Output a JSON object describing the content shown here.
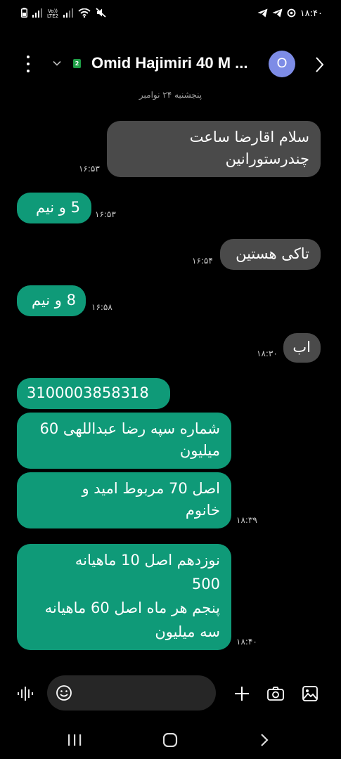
{
  "status_bar": {
    "time": "۱۸:۴۰",
    "network_label_top": "Vo))",
    "network_label_bottom": "LTE2",
    "icons": [
      "battery-icon",
      "signal-icon",
      "signal-icon",
      "wifi-icon",
      "mute-icon",
      "telegram-icon",
      "telegram-icon",
      "sync-icon"
    ]
  },
  "header": {
    "contact_name": "Omid Hajimiri 40 M ...",
    "sim_badge": "2",
    "avatar_letter": "O",
    "avatar_color": "#7d8ce6"
  },
  "date_label": "پنجشنبه ۲۴ نوامبر",
  "messages": [
    {
      "direction": "sent",
      "text": "سلام اقارضا ساعت\nچندرستورانین",
      "time": "۱۶:۵۳"
    },
    {
      "direction": "received",
      "text": "5 و نیم",
      "time": "۱۶:۵۳"
    },
    {
      "direction": "sent",
      "text": "تاکی هستین",
      "time": "۱۶:۵۴"
    },
    {
      "direction": "received",
      "text": "8 و نیم",
      "time": "۱۶:۵۸"
    },
    {
      "direction": "sent",
      "text": "اب",
      "time": "۱۸:۳۰"
    },
    {
      "direction": "received",
      "text": "3100003858318",
      "time": ""
    },
    {
      "direction": "received",
      "text": "شماره سپه رضا عبداللهی 60\nمیلیون",
      "time": ""
    },
    {
      "direction": "received",
      "text": "اصل 70 مربوط امید و\nخانوم",
      "time": "۱۸:۳۹"
    },
    {
      "direction": "received",
      "text": "نوزدهم اصل 10 ماهیانه\n500\nپنجم هر ماه اصل 60 ماهیانه\nسه میلیون",
      "time": "۱۸:۴۰"
    }
  ],
  "colors": {
    "sent_bubble": "#4a4a4a",
    "received_bubble": "#0f9a78",
    "background": "#000000",
    "input_field": "#262626"
  },
  "input_bar": {
    "placeholder": "",
    "icons": [
      "voice-icon",
      "emoji-icon",
      "plus-icon",
      "camera-icon",
      "gallery-icon"
    ]
  },
  "nav_bar": {
    "icons": [
      "recents-icon",
      "home-icon",
      "back-icon"
    ]
  }
}
